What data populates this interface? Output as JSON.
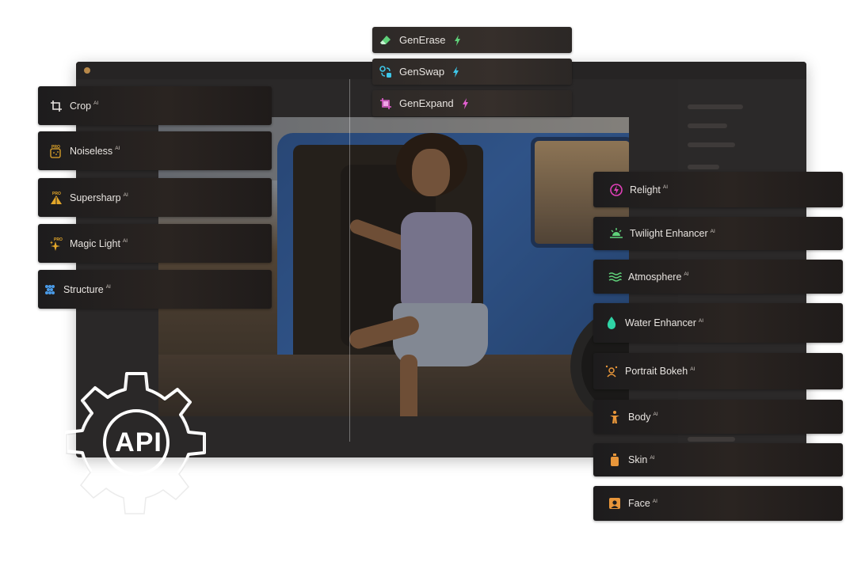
{
  "colors": {
    "pill_bg": "#1d1c1d",
    "text": "#e8e4e0",
    "generase_accent": "#5fd17a",
    "genswap_accent": "#3ec6e8",
    "genexpand_accent": "#e15fd0",
    "pro_gold": "#e3a72a",
    "relight_pink": "#e040b8"
  },
  "top_tools": [
    {
      "label": "GenErase",
      "icon": "eraser-icon",
      "badge": "lightning-icon"
    },
    {
      "label": "GenSwap",
      "icon": "swap-icon",
      "badge": "lightning-icon"
    },
    {
      "label": "GenExpand",
      "icon": "expand-icon",
      "badge": "lightning-icon"
    }
  ],
  "left_tools": [
    {
      "label": "Crop",
      "ai": "AI",
      "icon": "crop-icon"
    },
    {
      "label": "Noiseless",
      "ai": "AI",
      "icon": "pro-noiseless-icon"
    },
    {
      "label": "Supersharp",
      "ai": "AI",
      "icon": "pro-supersharp-icon"
    },
    {
      "label": "Magic Light",
      "ai": "AI",
      "icon": "pro-sparkle-icon"
    },
    {
      "label": "Structure",
      "ai": "AI",
      "icon": "structure-icon"
    }
  ],
  "right_tools": [
    {
      "label": "Relight",
      "ai": "AI",
      "icon": "relight-icon"
    },
    {
      "label": "Twilight Enhancer",
      "ai": "AI",
      "icon": "twilight-icon"
    },
    {
      "label": "Atmosphere",
      "ai": "AI",
      "icon": "atmosphere-icon"
    },
    {
      "label": "Water Enhancer",
      "ai": "AI",
      "icon": "water-drop-icon"
    },
    {
      "label": "Portrait Bokeh",
      "ai": "AI",
      "icon": "portrait-bokeh-icon"
    },
    {
      "label": "Body",
      "ai": "AI",
      "icon": "body-icon"
    },
    {
      "label": "Skin",
      "ai": "AI",
      "icon": "skin-icon"
    },
    {
      "label": "Face",
      "ai": "AI",
      "icon": "face-icon"
    }
  ],
  "api_badge": {
    "label": "API",
    "icon": "gear-icon"
  }
}
